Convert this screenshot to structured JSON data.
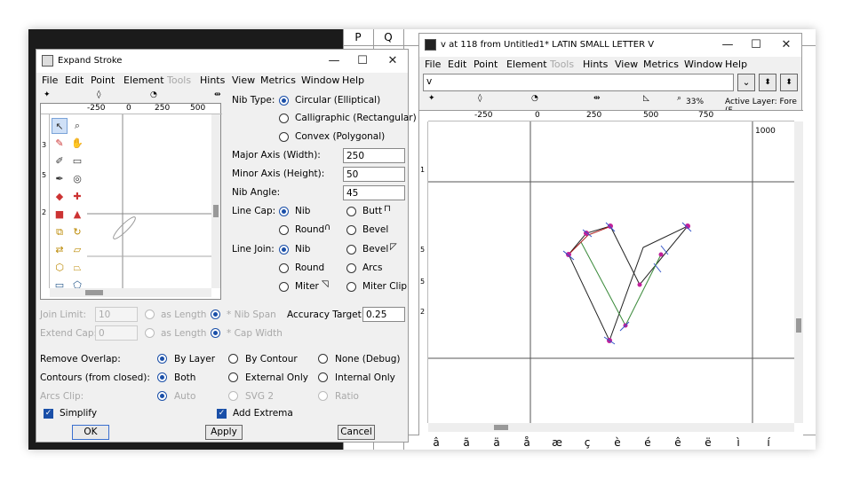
{
  "glyph_grid": {
    "top_row": [
      "P",
      "Q"
    ],
    "bottom_row": [
      "â",
      "ã",
      "ä",
      "å",
      "æ",
      "ç",
      "è",
      "é",
      "ê",
      "ë",
      "ì",
      "í"
    ]
  },
  "dialog": {
    "title": "Expand Stroke",
    "menu": [
      "File",
      "Edit",
      "Point",
      "Element",
      "Tools",
      "Hints",
      "View",
      "Metrics",
      "Window",
      "Help"
    ],
    "ruler_labels": [
      "-250",
      "0",
      "250",
      "500"
    ],
    "ruler_left": [
      "3",
      "5",
      "2"
    ],
    "nib_type": {
      "label": "Nib Type:",
      "options": [
        "Circular (Elliptical)",
        "Calligraphic (Rectangular)",
        "Convex (Polygonal)"
      ],
      "selected": 0
    },
    "major_axis": {
      "label": "Major Axis (Width):",
      "value": "250"
    },
    "minor_axis": {
      "label": "Minor Axis (Height):",
      "value": "50"
    },
    "nib_angle": {
      "label": "Nib Angle:",
      "value": "45"
    },
    "line_cap": {
      "label": "Line Cap:",
      "options": [
        "Nib",
        "Butt",
        "Round",
        "Bevel"
      ],
      "selected": 0
    },
    "line_join": {
      "label": "Line Join:",
      "options": [
        "Nib",
        "Bevel",
        "Round",
        "Arcs",
        "Miter",
        "Miter Clip"
      ],
      "selected": 0
    },
    "join_limit": {
      "label": "Join Limit:",
      "value": "10",
      "opt1": "as Length",
      "opt2": "* Nib Span"
    },
    "extend_cap": {
      "label": "Extend Cap:",
      "value": "0",
      "opt1": "as Length",
      "opt2": "* Cap Width"
    },
    "accuracy": {
      "label": "Accuracy Target:",
      "value": "0.25"
    },
    "remove_overlap": {
      "label": "Remove Overlap:",
      "options": [
        "By Layer",
        "By Contour",
        "None (Debug)"
      ]
    },
    "contours": {
      "label": "Contours (from closed):",
      "options": [
        "Both",
        "External Only",
        "Internal Only"
      ]
    },
    "arcs_clip": {
      "label": "Arcs Clip:",
      "options": [
        "Auto",
        "SVG 2",
        "Ratio"
      ]
    },
    "simplify": "Simplify",
    "add_extrema": "Add Extrema",
    "ok": "OK",
    "apply": "Apply",
    "cancel": "Cancel"
  },
  "editor": {
    "title": "v at 118 from Untitled1* LATIN SMALL LETTER V",
    "menu": [
      "File",
      "Edit",
      "Point",
      "Element",
      "Tools",
      "Hints",
      "View",
      "Metrics",
      "Window",
      "Help"
    ],
    "glyph_input": "v",
    "zoom": "33%",
    "active_layer": "Active Layer: Fore (F",
    "ruler_labels": [
      "-250",
      "0",
      "250",
      "500",
      "750"
    ],
    "ruler_left": [
      "1",
      "5",
      "5",
      "2"
    ],
    "advance_label": "1000"
  }
}
